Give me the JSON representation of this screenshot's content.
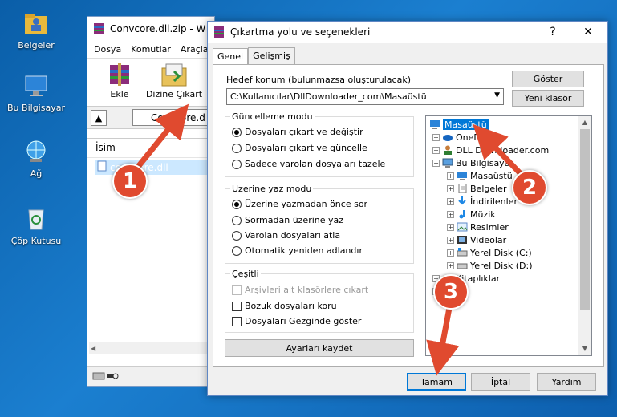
{
  "desktop": {
    "icons": [
      {
        "label": "Belgeler"
      },
      {
        "label": "Bu Bilgisayar"
      },
      {
        "label": "Ağ"
      },
      {
        "label": "Çöp Kutusu"
      }
    ]
  },
  "winrar": {
    "title": "Convcore.dll.zip - W",
    "menu": [
      "Dosya",
      "Komutlar",
      "Araçla"
    ],
    "toolbar": {
      "add_label": "Ekle",
      "extract_label": "Dizine Çıkart"
    },
    "address": "Convcore.d",
    "list_header": "İsim",
    "file_name": "convcore.dll"
  },
  "dialog": {
    "title": "Çıkartma yolu ve seçenekleri",
    "help_label": "?",
    "close_label": "✕",
    "tabs": [
      "Genel",
      "Gelişmiş"
    ],
    "destination_label": "Hedef konum (bulunmazsa oluşturulacak)",
    "destination_value": "C:\\Kullanıcılar\\DllDownloader_com\\Masaüstü",
    "show_button": "Göster",
    "new_folder_button": "Yeni klasör",
    "update_mode": {
      "title": "Güncelleme modu",
      "options": [
        {
          "label": "Dosyaları çıkart ve değiştir",
          "checked": true
        },
        {
          "label": "Dosyaları çıkart ve güncelle",
          "checked": false
        },
        {
          "label": "Sadece varolan dosyaları tazele",
          "checked": false
        }
      ]
    },
    "overwrite_mode": {
      "title": "Üzerine yaz modu",
      "options": [
        {
          "label": "Üzerine yazmadan önce sor",
          "checked": true
        },
        {
          "label": "Sormadan üzerine yaz",
          "checked": false
        },
        {
          "label": "Varolan dosyaları atla",
          "checked": false
        },
        {
          "label": "Otomatik yeniden adlandır",
          "checked": false
        }
      ]
    },
    "misc": {
      "title": "Çeşitli",
      "options": [
        {
          "label": "Arşivleri alt klasörlere çıkart",
          "checked": false,
          "disabled": true
        },
        {
          "label": "Bozuk dosyaları koru",
          "checked": false,
          "disabled": false
        },
        {
          "label": "Dosyaları Gezginde göster",
          "checked": false,
          "disabled": false
        }
      ]
    },
    "save_settings_button": "Ayarları kaydet",
    "tree": [
      {
        "label": "Masaüstü",
        "icon": "desktop-icon",
        "selected": true
      },
      {
        "label": "OneDr",
        "icon": "onedrive-icon"
      },
      {
        "label": "DLL Downloader.com",
        "icon": "user-icon"
      },
      {
        "label": "Bu Bilgisayar",
        "icon": "computer-icon"
      },
      {
        "label": "Masaüstü",
        "icon": "desktop-icon"
      },
      {
        "label": "Belgeler",
        "icon": "documents-icon"
      },
      {
        "label": "İndirilenler",
        "icon": "downloads-icon"
      },
      {
        "label": "Müzik",
        "icon": "music-icon"
      },
      {
        "label": "Resimler",
        "icon": "pictures-icon"
      },
      {
        "label": "Videolar",
        "icon": "videos-icon"
      },
      {
        "label": "Yerel Disk (C:)",
        "icon": "drive-icon"
      },
      {
        "label": "Yerel Disk (D:)",
        "icon": "drive-icon"
      },
      {
        "label": "Kitaplıklar",
        "icon": "folder-icon"
      },
      {
        "label": "Ağ",
        "icon": "network-icon"
      }
    ],
    "ok_button": "Tamam",
    "cancel_button": "İptal",
    "help_button": "Yardım"
  },
  "annotations": {
    "step1": "1",
    "step2": "2",
    "step3": "3",
    "color": "#e04a2f"
  }
}
